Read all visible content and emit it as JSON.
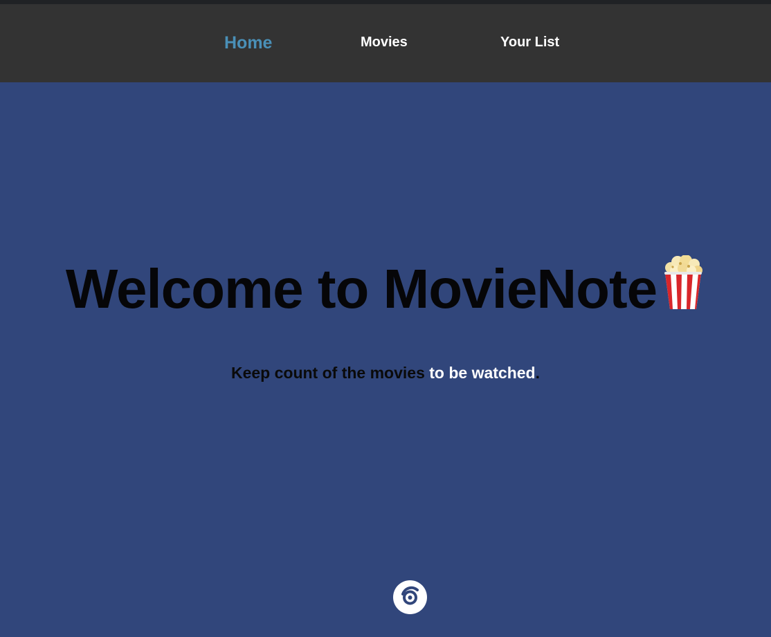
{
  "nav": {
    "items": [
      {
        "label": "Home",
        "active": true
      },
      {
        "label": "Movies",
        "active": false
      },
      {
        "label": "Your List",
        "active": false
      }
    ],
    "active_color": "#4a90b8",
    "text_color": "#ffffff",
    "background": "#333333"
  },
  "hero": {
    "title": "Welcome to MovieNote",
    "title_icon": "popcorn-icon",
    "tagline": {
      "part1": "Keep count of the movies",
      "part2": "to be watched",
      "part3": "."
    },
    "tagline_colors": {
      "part1": "#0a0a0a",
      "part2": "#ffffff",
      "part3": "#0a0a0a"
    },
    "background": "#31467b",
    "scroll_icon": "scroll-target-icon"
  }
}
